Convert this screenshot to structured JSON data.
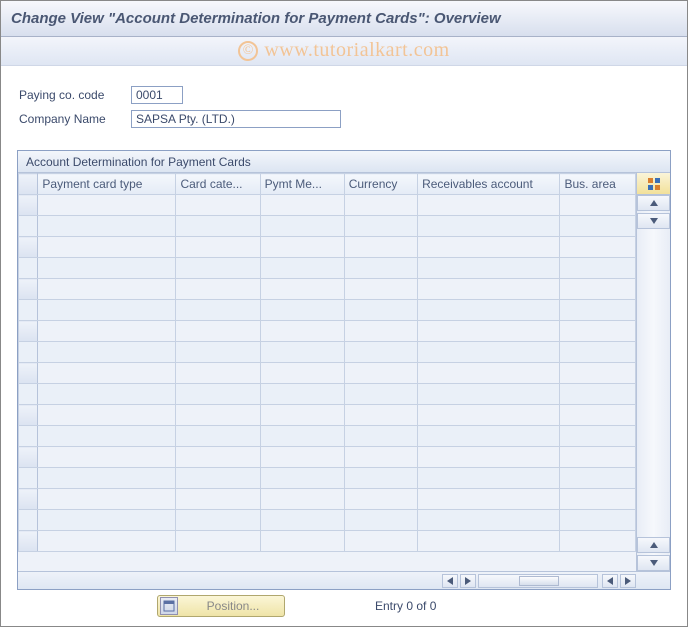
{
  "header": {
    "title": "Change View \"Account Determination for Payment Cards\": Overview"
  },
  "watermark": "www.tutorialkart.com",
  "form": {
    "paying_co_code_label": "Paying co. code",
    "paying_co_code_value": "0001",
    "company_name_label": "Company Name",
    "company_name_value": "SAPSA Pty. (LTD.)"
  },
  "table": {
    "title": "Account Determination for Payment Cards",
    "columns": [
      "Payment card type",
      "Card cate...",
      "Pymt Me...",
      "Currency",
      "Receivables account",
      "Bus. area"
    ],
    "row_count": 17,
    "rows": []
  },
  "footer": {
    "position_button_label": "Position...",
    "entry_text": "Entry 0 of 0"
  },
  "colors": {
    "accent_blue": "#3b4a6b",
    "panel_bg": "#eef2f9",
    "border": "#8ca0c4",
    "yellow_btn": "#efe4a7"
  }
}
